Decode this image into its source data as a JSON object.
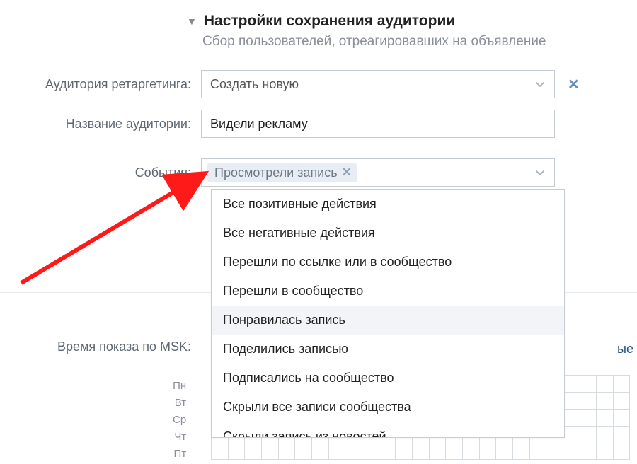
{
  "section": {
    "title": "Настройки сохранения аудитории",
    "subtitle": "Сбор пользователей, отреагировавших на объявление"
  },
  "labels": {
    "retargeting": "Аудитория ретаргетинга:",
    "audience_name": "Название аудитории:",
    "events": "События:",
    "time": "Время показа по MSK:"
  },
  "retargeting_select": {
    "value": "Создать новую"
  },
  "audience_name_input": {
    "value": "Видели рекламу"
  },
  "events_input": {
    "chip": "Просмотрели запись"
  },
  "dropdown": {
    "items": [
      "Все позитивные действия",
      "Все негативные действия",
      "Перешли по ссылке или в сообщество",
      "Перешли в сообщество",
      "Понравилась запись",
      "Поделились записью",
      "Подписались на сообщество",
      "Скрыли все записи сообщества",
      "Скрыли запись из новостей"
    ],
    "hover_index": 4
  },
  "days": [
    "Пн",
    "Вт",
    "Ср",
    "Чт",
    "Пт"
  ],
  "side_link": "ые",
  "colors": {
    "accent": "#2a5885",
    "border": "#c5ccd4",
    "subtext": "#8a8f99"
  }
}
